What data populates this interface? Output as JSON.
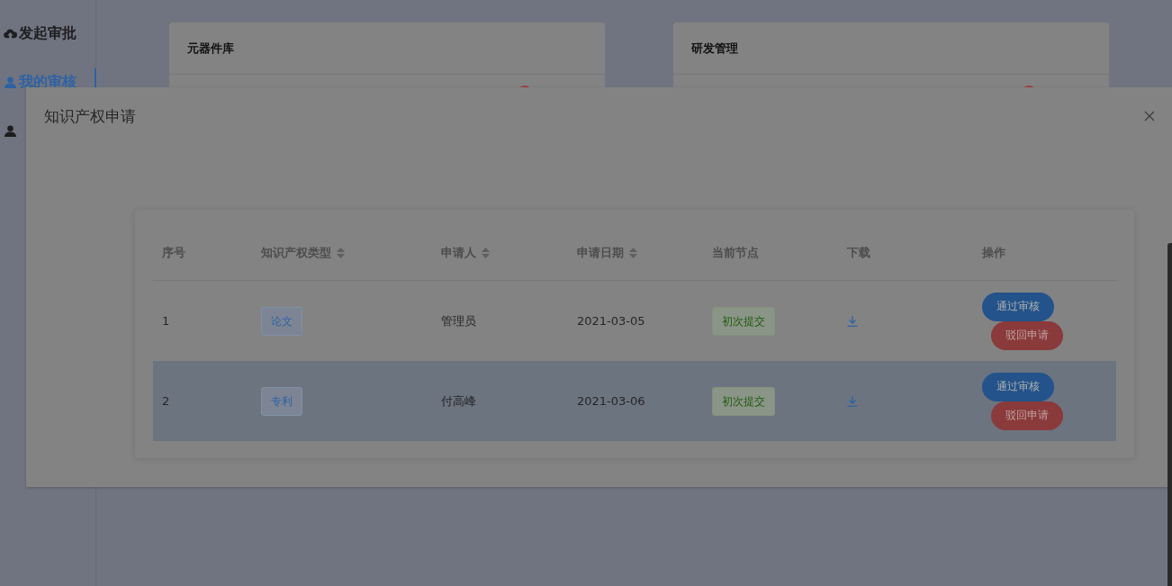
{
  "sidebar": {
    "items": [
      {
        "label": "发起审批",
        "selected": false
      },
      {
        "label": "我的审核",
        "selected": true
      }
    ]
  },
  "cards": [
    {
      "title": "元器件库"
    },
    {
      "title": "研发管理"
    }
  ],
  "dialog": {
    "title": "知识产权申请",
    "table": {
      "columns": [
        {
          "label": "序号",
          "sortable": false
        },
        {
          "label": "知识产权类型",
          "sortable": true
        },
        {
          "label": "申请人",
          "sortable": true
        },
        {
          "label": "申请日期",
          "sortable": true
        },
        {
          "label": "当前节点",
          "sortable": false
        },
        {
          "label": "下载",
          "sortable": false
        },
        {
          "label": "操作",
          "sortable": false
        }
      ],
      "rows": [
        {
          "index": "1",
          "type": "论文",
          "applicant": "管理员",
          "date": "2021-03-05",
          "node": "初次提交",
          "selected": false,
          "actions": [
            "通过审核",
            "驳回申请"
          ]
        },
        {
          "index": "2",
          "type": "专利",
          "applicant": "付高峰",
          "date": "2021-03-06",
          "node": "初次提交",
          "selected": true,
          "actions": [
            "通过审核",
            "驳回申请"
          ]
        }
      ]
    }
  }
}
